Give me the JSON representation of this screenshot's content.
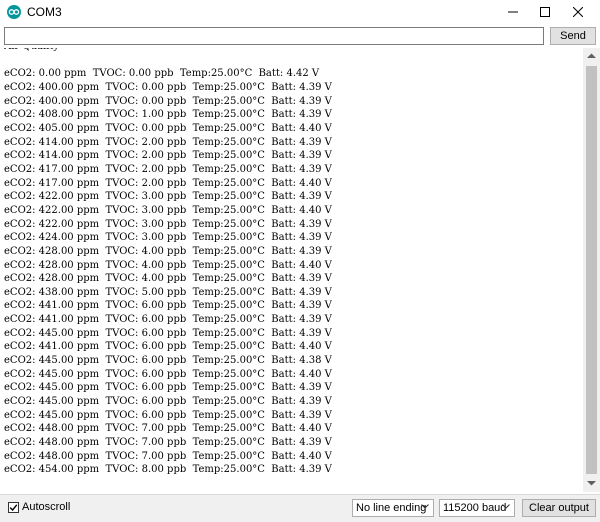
{
  "window": {
    "title": "COM3"
  },
  "input": {
    "value": "",
    "send_label": "Send"
  },
  "output": {
    "lines": [
      "Air Quality",
      "",
      "eCO2: 0.00 ppm  TVOC: 0.00 ppb  Temp:25.00°C  Batt: 4.42 V",
      "eCO2: 400.00 ppm  TVOC: 0.00 ppb  Temp:25.00°C  Batt: 4.39 V",
      "eCO2: 400.00 ppm  TVOC: 0.00 ppb  Temp:25.00°C  Batt: 4.39 V",
      "eCO2: 408.00 ppm  TVOC: 1.00 ppb  Temp:25.00°C  Batt: 4.39 V",
      "eCO2: 405.00 ppm  TVOC: 0.00 ppb  Temp:25.00°C  Batt: 4.40 V",
      "eCO2: 414.00 ppm  TVOC: 2.00 ppb  Temp:25.00°C  Batt: 4.39 V",
      "eCO2: 414.00 ppm  TVOC: 2.00 ppb  Temp:25.00°C  Batt: 4.39 V",
      "eCO2: 417.00 ppm  TVOC: 2.00 ppb  Temp:25.00°C  Batt: 4.39 V",
      "eCO2: 417.00 ppm  TVOC: 2.00 ppb  Temp:25.00°C  Batt: 4.40 V",
      "eCO2: 422.00 ppm  TVOC: 3.00 ppb  Temp:25.00°C  Batt: 4.39 V",
      "eCO2: 422.00 ppm  TVOC: 3.00 ppb  Temp:25.00°C  Batt: 4.40 V",
      "eCO2: 422.00 ppm  TVOC: 3.00 ppb  Temp:25.00°C  Batt: 4.39 V",
      "eCO2: 424.00 ppm  TVOC: 3.00 ppb  Temp:25.00°C  Batt: 4.39 V",
      "eCO2: 428.00 ppm  TVOC: 4.00 ppb  Temp:25.00°C  Batt: 4.39 V",
      "eCO2: 428.00 ppm  TVOC: 4.00 ppb  Temp:25.00°C  Batt: 4.40 V",
      "eCO2: 428.00 ppm  TVOC: 4.00 ppb  Temp:25.00°C  Batt: 4.39 V",
      "eCO2: 438.00 ppm  TVOC: 5.00 ppb  Temp:25.00°C  Batt: 4.39 V",
      "eCO2: 441.00 ppm  TVOC: 6.00 ppb  Temp:25.00°C  Batt: 4.39 V",
      "eCO2: 441.00 ppm  TVOC: 6.00 ppb  Temp:25.00°C  Batt: 4.39 V",
      "eCO2: 445.00 ppm  TVOC: 6.00 ppb  Temp:25.00°C  Batt: 4.39 V",
      "eCO2: 441.00 ppm  TVOC: 6.00 ppb  Temp:25.00°C  Batt: 4.40 V",
      "eCO2: 445.00 ppm  TVOC: 6.00 ppb  Temp:25.00°C  Batt: 4.38 V",
      "eCO2: 445.00 ppm  TVOC: 6.00 ppb  Temp:25.00°C  Batt: 4.40 V",
      "eCO2: 445.00 ppm  TVOC: 6.00 ppb  Temp:25.00°C  Batt: 4.39 V",
      "eCO2: 445.00 ppm  TVOC: 6.00 ppb  Temp:25.00°C  Batt: 4.39 V",
      "eCO2: 445.00 ppm  TVOC: 6.00 ppb  Temp:25.00°C  Batt: 4.39 V",
      "eCO2: 448.00 ppm  TVOC: 7.00 ppb  Temp:25.00°C  Batt: 4.40 V",
      "eCO2: 448.00 ppm  TVOC: 7.00 ppb  Temp:25.00°C  Batt: 4.39 V",
      "eCO2: 448.00 ppm  TVOC: 7.00 ppb  Temp:25.00°C  Batt: 4.40 V",
      "eCO2: 454.00 ppm  TVOC: 8.00 ppb  Temp:25.00°C  Batt: 4.39 V"
    ]
  },
  "statusbar": {
    "autoscroll_label": "Autoscroll",
    "autoscroll_checked": true,
    "line_ending": "No line ending",
    "baud_rate": "115200 baud",
    "clear_label": "Clear output"
  },
  "colors": {
    "app_icon": "#00979c",
    "button_bg": "#e1e1e1",
    "statusbar_bg": "#f0f0f0",
    "scroll_thumb": "#c1c1c1"
  },
  "icons": {
    "app": "arduino-icon",
    "minimize": "minimize-icon",
    "maximize": "maximize-icon",
    "close": "close-icon"
  }
}
